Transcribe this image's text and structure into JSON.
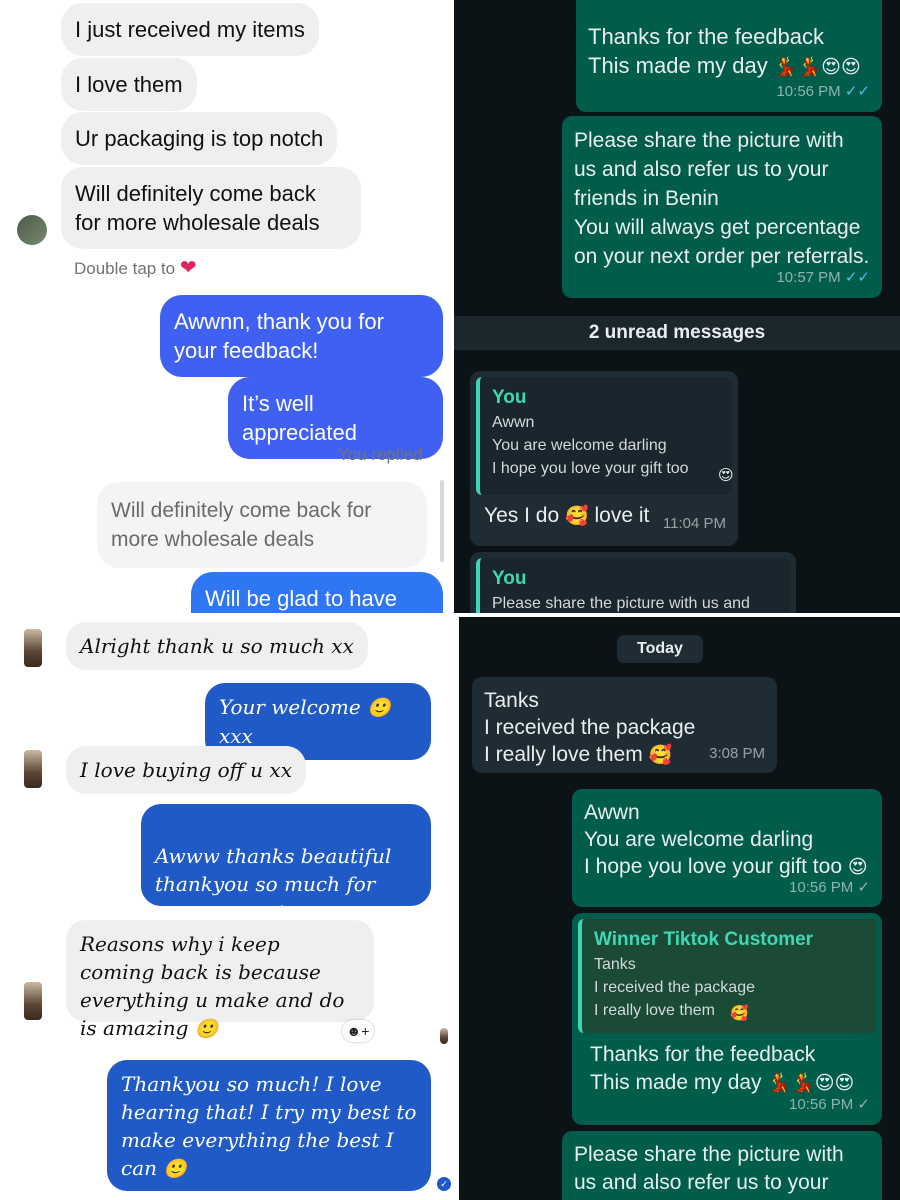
{
  "top_left": {
    "messages_in": [
      "I just received my items",
      "I love them",
      "Ur packaging is top notch",
      "Will definitely come back for more wholesale deals"
    ],
    "double_tap": "Double tap to",
    "heart": "❤",
    "out_1": "Awwnn, thank you for your feedback!",
    "out_2": "It’s well appreciated",
    "you_replied": "You replied",
    "replied_quote": "Will definitely come back for more wholesale deals",
    "out_3": "Will be glad to have you"
  },
  "top_right": {
    "m1_line1": "Thanks for the feedback",
    "m1_line2": "This made my day",
    "m1_emoji": "💃💃😍😍",
    "m1_time": "10:56 PM",
    "m2_text": "Please share the picture with us and also refer us to your friends in Benin\nYou will always get percentage on your next order per referrals.",
    "m2_time": "10:57 PM",
    "unread": "2 unread messages",
    "r1_quote_name": "You",
    "r1_quote_text": "Awwn\nYou are welcome darling\nI hope you love your gift too",
    "r1_quote_emoji": "😍",
    "r1_text": "Yes I do",
    "r1_emoji": "🥰",
    "r1_text2": "love it",
    "r1_time": "11:04 PM",
    "r2_quote_name": "You",
    "r2_quote_text": "Please share the picture with us and"
  },
  "bottom_left": {
    "in_1": "Alright thank u so much xx",
    "out_1": "Your welcome",
    "out_1_tail": "xxx",
    "in_2": "I love buying off u xx",
    "out_2": "Awww thanks beautiful\nthankyou so much for your support",
    "in_3": "Reasons why i keep coming back is because everything u make and do is amazing",
    "out_3": "Thankyou so much! I love hearing that! I try my best to make everything the best I can",
    "smile": "🙂",
    "reaction": "☻+",
    "seen": "✓"
  },
  "bottom_right": {
    "today": "Today",
    "in_1": "Tanks\nI received the package\nI really love them",
    "in_1_emoji": "🥰",
    "in_1_time": "3:08 PM",
    "out_1": "Awwn\nYou are welcome darling\nI hope you love your gift too",
    "out_1_emoji": "😍",
    "out_1_time": "10:56 PM",
    "quote_name": "Winner Tiktok Customer",
    "quote_text": "Tanks\nI received the package\nI really love them",
    "quote_emoji": "🥰",
    "out_2_line1": "Thanks for the feedback",
    "out_2_line2": "This made my day",
    "out_2_emoji": "💃💃😍😍",
    "out_2_time": "10:56 PM",
    "out_3": "Please share the picture with us and also refer us to your friends"
  },
  "ticks": {
    "double": "✓✓",
    "single": "✓"
  }
}
